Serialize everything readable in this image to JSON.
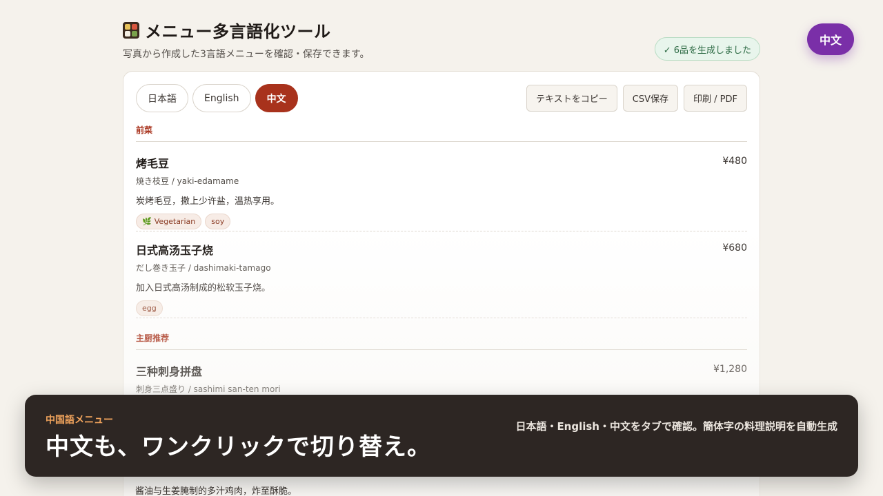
{
  "header": {
    "title": "メニュー多言語化ツール",
    "subtitle": "写真から作成した3言語メニューを確認・保存できます。",
    "status": "✓ 6品を生成しました"
  },
  "language_button": "中文",
  "tabs": [
    {
      "label": "日本語",
      "active": false
    },
    {
      "label": "English",
      "active": false
    },
    {
      "label": "中文",
      "active": true
    }
  ],
  "actions": {
    "copy": "テキストをコピー",
    "csv": "CSV保存",
    "print": "印刷 / PDF"
  },
  "sections": [
    {
      "title": "前菜",
      "items": [
        {
          "name": "烤毛豆",
          "price": "¥480",
          "original": "焼き枝豆 / yaki-edamame",
          "description": "炭烤毛豆，撒上少许盐，温热享用。",
          "tags": [
            {
              "icon": "🌿",
              "label": "Vegetarian"
            },
            {
              "icon": "",
              "label": "soy"
            }
          ]
        },
        {
          "name": "日式高汤玉子烧",
          "price": "¥680",
          "original": "だし巻き玉子 / dashimaki-tamago",
          "description": "加入日式高汤制成的松软玉子烧。",
          "tags": [
            {
              "icon": "",
              "label": "egg"
            }
          ]
        }
      ]
    },
    {
      "title": "主厨推荐",
      "items": [
        {
          "name": "三种刺身拼盘",
          "price": "¥1,280",
          "original": "刺身三点盛り / sashimi san-ten mori",
          "description": "",
          "tags": []
        }
      ]
    }
  ],
  "partial_description": "酱油与生姜腌制的多汁鸡肉，炸至酥脆。",
  "banner": {
    "kicker": "中国語メニュー",
    "headline": "中文も、ワンクリックで切り替え。",
    "note": "日本語・English・中文をタブで確認。簡体字の料理説明を自動生成"
  },
  "colors": {
    "accent": "#a8321c",
    "language_button": "#7a2fa8",
    "status_bg": "#e8f5ec",
    "banner_bg": "#2d2623",
    "banner_kicker": "#f0a35c"
  }
}
